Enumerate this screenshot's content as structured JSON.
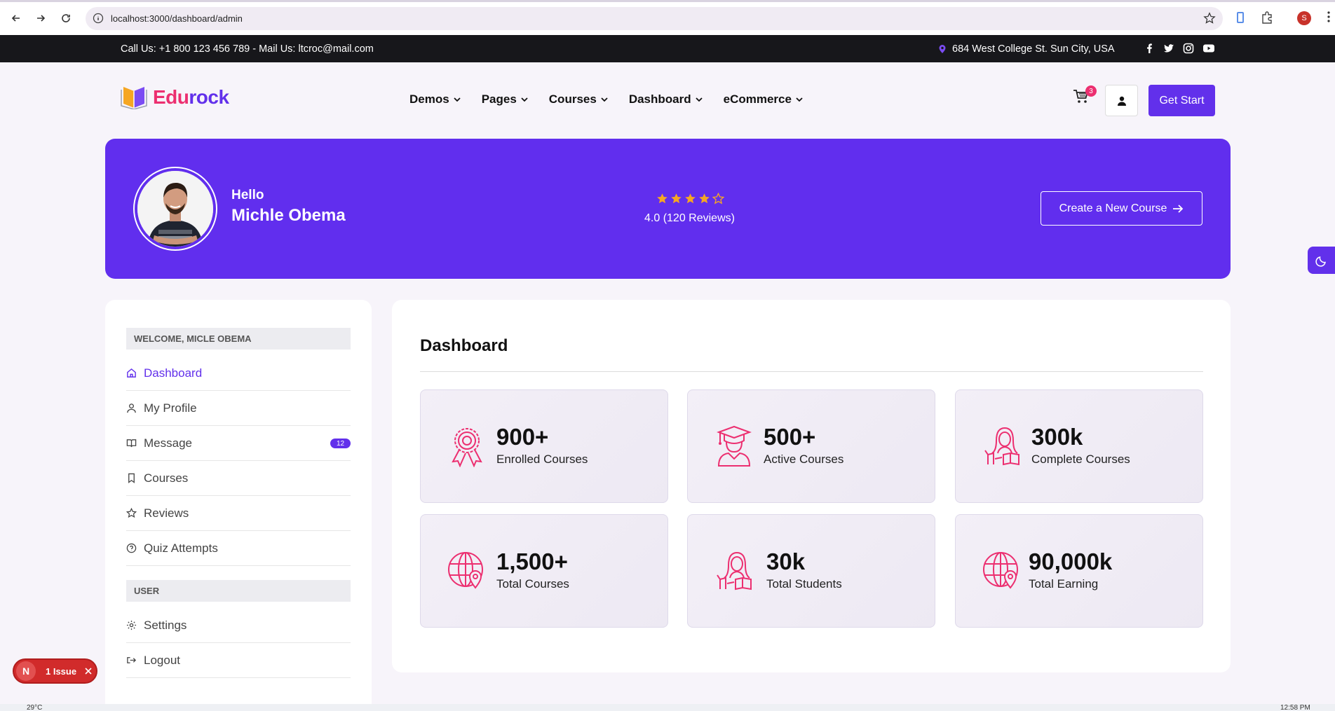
{
  "browser": {
    "url": "localhost:3000/dashboard/admin",
    "profile_initial": "S"
  },
  "topbar": {
    "contact": "Call Us: +1 800 123 456 789 - Mail Us: ltcroc@mail.com",
    "address": "684 West College St. Sun City, USA",
    "socials": [
      "facebook-icon",
      "twitter-icon",
      "instagram-icon",
      "youtube-icon"
    ]
  },
  "header": {
    "brand_part1": "Edu",
    "brand_part2": "rock",
    "nav": [
      "Demos",
      "Pages",
      "Courses",
      "Dashboard",
      "eCommerce"
    ],
    "cart_count": "3",
    "cta_label": "Get Start"
  },
  "hero": {
    "greeting": "Hello",
    "name": "Michle Obema",
    "rating_text": "4.0 (120 Reviews)",
    "rating_value": 4,
    "rating_max": 5,
    "create_label": "Create a New Course"
  },
  "sidebar": {
    "welcome": "WELCOME, MICLE OBEMA",
    "items": [
      {
        "label": "Dashboard",
        "icon": "home-icon"
      },
      {
        "label": "My Profile",
        "icon": "user-icon"
      },
      {
        "label": "Message",
        "icon": "book-open-icon",
        "badge": "12"
      },
      {
        "label": "Courses",
        "icon": "bookmark-icon"
      },
      {
        "label": "Reviews",
        "icon": "star-icon"
      },
      {
        "label": "Quiz Attempts",
        "icon": "help-circle-icon"
      }
    ],
    "user_section": "USER",
    "user_items": [
      {
        "label": "Settings",
        "icon": "gear-icon"
      },
      {
        "label": "Logout",
        "icon": "logout-icon"
      }
    ]
  },
  "main": {
    "title": "Dashboard",
    "stats": [
      {
        "value": "900+",
        "label": "Enrolled Courses",
        "icon": "award-icon"
      },
      {
        "value": "500+",
        "label": "Active Courses",
        "icon": "graduate-icon"
      },
      {
        "value": "300k",
        "label": "Complete Courses",
        "icon": "student-reading-icon"
      },
      {
        "value": "1,500+",
        "label": "Total Courses",
        "icon": "globe-location-icon"
      },
      {
        "value": "30k",
        "label": "Total Students",
        "icon": "student-reading-icon"
      },
      {
        "value": "90,000k",
        "label": "Total Earning",
        "icon": "globe-location-icon"
      }
    ]
  },
  "overlay": {
    "issue_label": "1 Issue",
    "issue_initial": "N"
  },
  "taskbar": {
    "temperature": "29°C",
    "time": "12:58 PM"
  },
  "colors": {
    "primary": "#6230eb",
    "accent": "#ec2f70",
    "topbar": "#17171b",
    "issue": "#d12b2b"
  }
}
